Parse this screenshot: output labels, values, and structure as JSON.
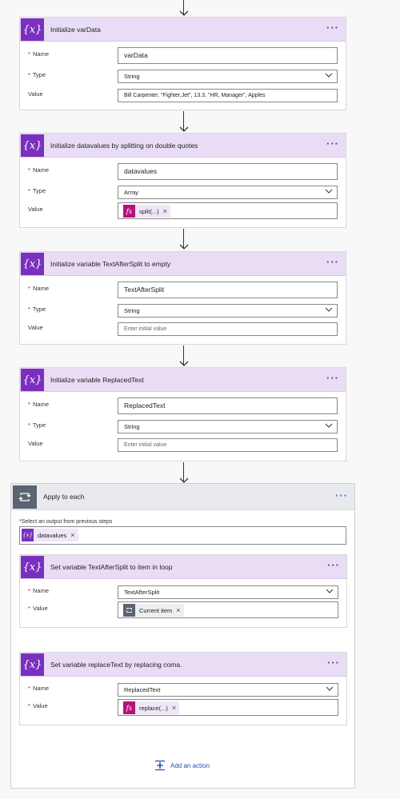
{
  "colors": {
    "variable_accent": "#7b2fbf",
    "header_bg": "#e9ddf5",
    "expression_accent": "#b4127b",
    "loop_accent": "#5a6473",
    "link": "#1f4fbf"
  },
  "steps": [
    {
      "title": "Initialize varData",
      "icon": "variable-icon",
      "fields": [
        {
          "label": "Name",
          "required": true,
          "value": "varData"
        },
        {
          "label": "Type",
          "required": true,
          "value": "String"
        },
        {
          "label": "Value",
          "required": false,
          "value": "Bill Carpenter, \"Fighter,Jet\", 13.3, \"HR, Manager\", Apples"
        }
      ]
    },
    {
      "title": "Initialize datavalues by splitting on double quotes",
      "icon": "variable-icon",
      "fields": [
        {
          "label": "Name",
          "required": true,
          "value": "datavalues"
        },
        {
          "label": "Type",
          "required": true,
          "value": "Array"
        },
        {
          "label": "Value",
          "required": false,
          "token": "split(...)"
        }
      ]
    },
    {
      "title": "Initialize variable TextAfterSplit to empty",
      "icon": "variable-icon",
      "fields": [
        {
          "label": "Name",
          "required": true,
          "value": "TextAfterSplit"
        },
        {
          "label": "Type",
          "required": true,
          "value": "String"
        },
        {
          "label": "Value",
          "required": false,
          "placeholder": "Enter initial value"
        }
      ]
    },
    {
      "title": "Initialize variable ReplacedText",
      "icon": "variable-icon",
      "fields": [
        {
          "label": "Name",
          "required": true,
          "value": "ReplacedText"
        },
        {
          "label": "Type",
          "required": true,
          "value": "String"
        },
        {
          "label": "Value",
          "required": false,
          "placeholder": "Enter initial value"
        }
      ]
    }
  ],
  "apply_to_each": {
    "title": "Apply to each",
    "select_label": "Select an output from previous steps",
    "select_token": "datavalues",
    "inner_steps": [
      {
        "title": "Set variable TextAfterSplit to item in loop",
        "fields": [
          {
            "label": "Name",
            "required": true,
            "value": "TextAfterSplit"
          },
          {
            "label": "Value",
            "required": true,
            "token": "Current item"
          }
        ]
      },
      {
        "title": "Set variable replaceText by replacing coma.",
        "fields": [
          {
            "label": "Name",
            "required": true,
            "value": "ReplacedText"
          },
          {
            "label": "Value",
            "required": true,
            "token": "replace(...)"
          }
        ]
      }
    ],
    "add_action": "Add an action"
  }
}
